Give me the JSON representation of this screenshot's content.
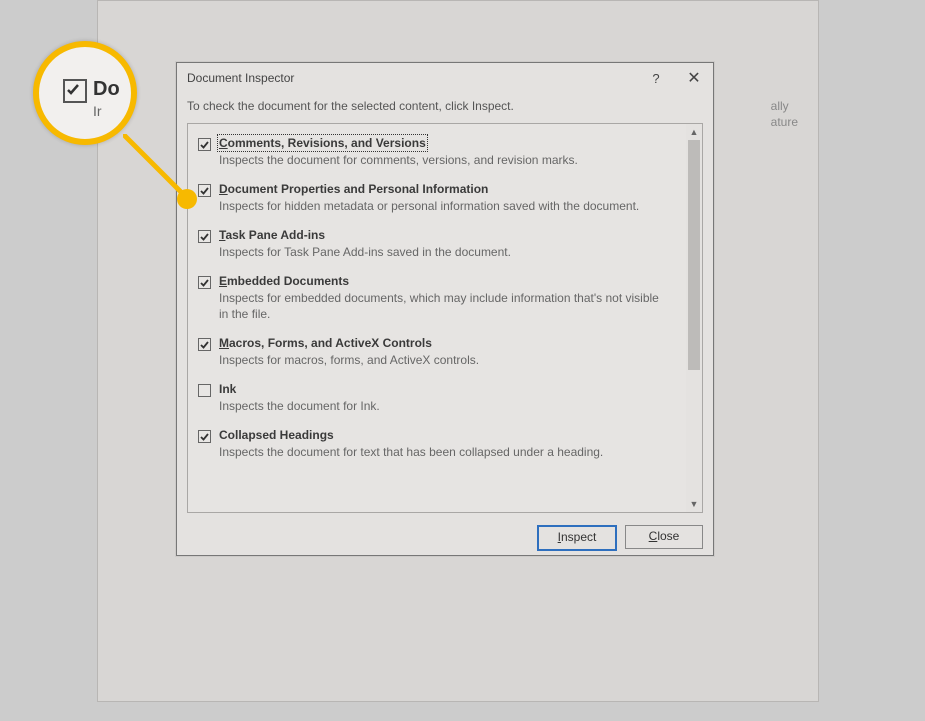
{
  "dialog": {
    "title": "Document Inspector",
    "instruction": "To check the document for the selected content, click Inspect.",
    "items": [
      {
        "checked": true,
        "focus": true,
        "mnemonic": "C",
        "label_rest": "omments, Revisions, and Versions",
        "desc": "Inspects the document for comments, versions, and revision marks."
      },
      {
        "checked": true,
        "focus": false,
        "mnemonic": "D",
        "label_rest": "ocument Properties and Personal Information",
        "desc": "Inspects for hidden metadata or personal information saved with the document."
      },
      {
        "checked": true,
        "focus": false,
        "mnemonic": "T",
        "label_rest": "ask Pane Add-ins",
        "desc": "Inspects for Task Pane Add-ins saved in the document."
      },
      {
        "checked": true,
        "focus": false,
        "mnemonic": "E",
        "label_rest": "mbedded Documents",
        "desc": "Inspects for embedded documents, which may include information that's not visible in the file."
      },
      {
        "checked": true,
        "focus": false,
        "mnemonic": "M",
        "label_rest": "acros, Forms, and ActiveX Controls",
        "desc": "Inspects for macros, forms, and ActiveX controls."
      },
      {
        "checked": false,
        "focus": false,
        "mnemonic": "",
        "label_rest": "Ink",
        "desc": "Inspects the document for Ink."
      },
      {
        "checked": true,
        "focus": false,
        "mnemonic": "",
        "label_rest": "Collapsed Headings",
        "desc": "Inspects the document for text that has been collapsed under a heading."
      }
    ],
    "buttons": {
      "primary_mn": "I",
      "primary_rest": "nspect",
      "secondary_mn": "C",
      "secondary_rest": "lose"
    }
  },
  "background": {
    "line1": "ally",
    "line2": "ature"
  },
  "zoom": {
    "label": "Do"
  }
}
